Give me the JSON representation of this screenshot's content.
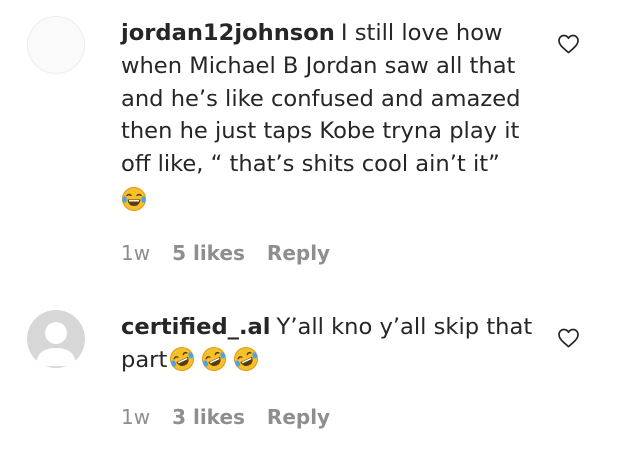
{
  "comments": [
    {
      "username": "jordan12johnson",
      "text": "I still love how when Michael B Jordan saw all that and he’s like confused and amazed then he just taps Kobe tryna play it off like, “ that’s shits cool ain’t it”",
      "emojis": [
        "face-with-tears-of-joy"
      ],
      "time": "1w",
      "likes": "5 likes",
      "reply": "Reply",
      "avatar": "blank"
    },
    {
      "username": "certified_.al",
      "text": "Y’all kno y’all skip that part",
      "emojis": [
        "rolling-on-the-floor-laughing",
        "rolling-on-the-floor-laughing",
        "rolling-on-the-floor-laughing"
      ],
      "time": "1w",
      "likes": "3 likes",
      "reply": "Reply",
      "avatar": "default"
    }
  ],
  "colors": {
    "text": "#262626",
    "muted": "#8e8e8e",
    "emoji_face": "#f7c02b",
    "emoji_tears": "#4aa3e8"
  },
  "icons": {
    "like": "heart-icon",
    "avatar_default": "default-avatar-icon"
  }
}
